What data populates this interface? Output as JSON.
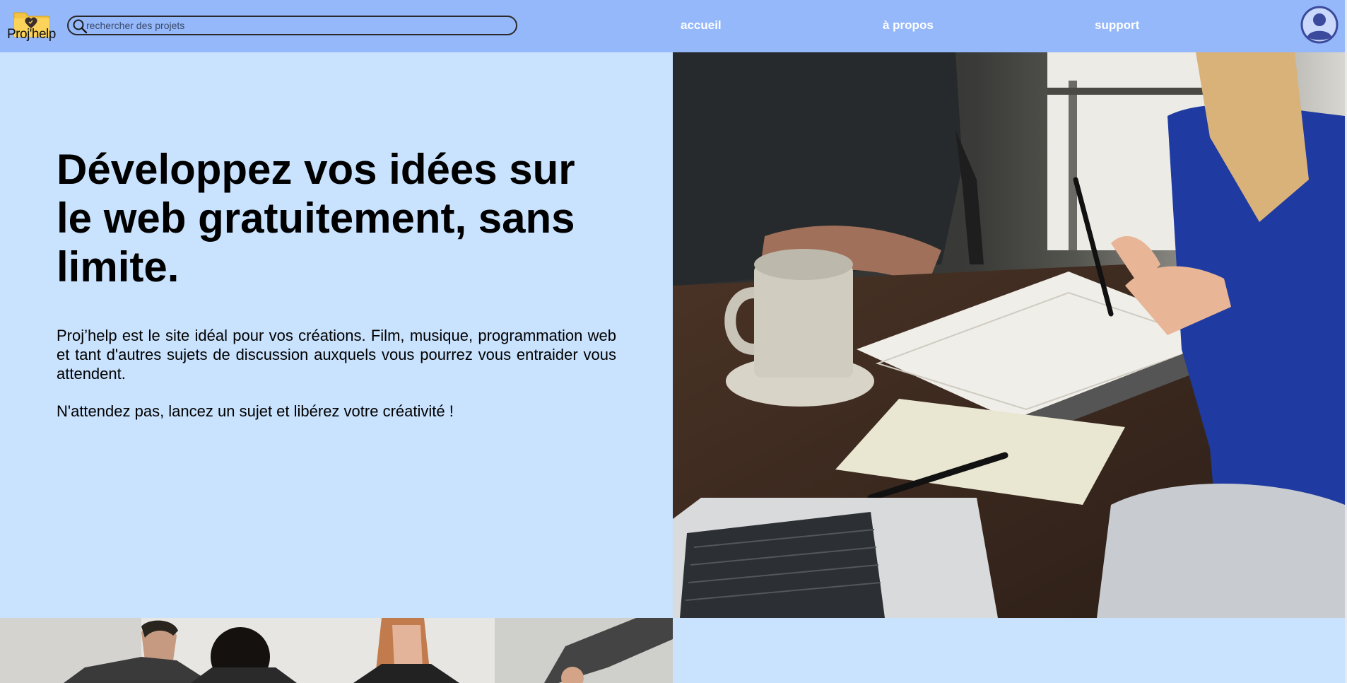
{
  "header": {
    "logo_text": "Proj'help",
    "search": {
      "placeholder": "rechercher des projets",
      "value": ""
    },
    "nav": [
      {
        "label": "accueil"
      },
      {
        "label": "à propos"
      },
      {
        "label": "support"
      }
    ]
  },
  "hero": {
    "title": "Développez vos idées sur le web gratuitement, sans limite.",
    "description": "Proj’help est le site idéal pour vos créations. Film, musique, programmation web et tant d'autres sujets de discussion auxquels vous pourrez vous entraider vous attendent.",
    "cta": "N'attendez pas, lancez un sujet et libérez votre créativité !"
  },
  "icons": {
    "logo": "folder-heart-logo-icon",
    "search": "search-icon",
    "account": "user-account-icon"
  },
  "colors": {
    "header_bg": "#95b8fb",
    "content_bg": "#c9e2fd",
    "nav_text": "#ffffff",
    "avatar": "#3b4a9c",
    "logo_folder": "#f3c443"
  }
}
